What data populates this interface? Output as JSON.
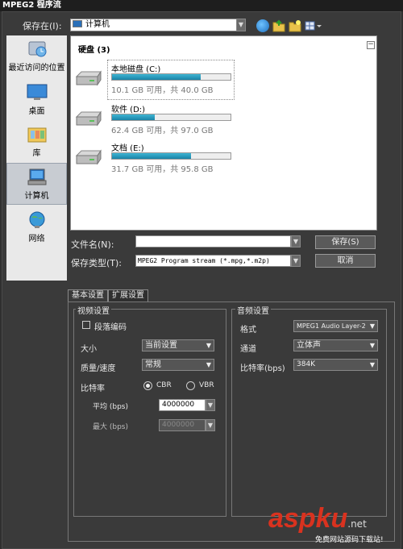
{
  "window": {
    "title": "MPEG2 程序流"
  },
  "save_in": {
    "label": "保存在(I):",
    "value": "计算机"
  },
  "places": [
    {
      "label": "最近访问的位置",
      "icon": "recent-places-icon",
      "selected": false
    },
    {
      "label": "桌面",
      "icon": "desktop-icon",
      "selected": false
    },
    {
      "label": "库",
      "icon": "library-icon",
      "selected": false
    },
    {
      "label": "计算机",
      "icon": "computer-icon",
      "selected": true
    },
    {
      "label": "网络",
      "icon": "network-icon",
      "selected": false
    }
  ],
  "filelist": {
    "group_title": "硬盘 (3)",
    "drives": [
      {
        "name": "本地磁盘 (C:)",
        "size_text": "10.1 GB 可用，共 40.0 GB",
        "used_fraction": 0.75
      },
      {
        "name": "软件 (D:)",
        "size_text": "62.4 GB 可用，共 97.0 GB",
        "used_fraction": 0.36
      },
      {
        "name": "文档 (E:)",
        "size_text": "31.7 GB 可用，共 95.8 GB",
        "used_fraction": 0.67
      }
    ]
  },
  "file_name": {
    "label": "文件名(N):",
    "value": ""
  },
  "save_type": {
    "label": "保存类型(T):",
    "value": "MPEG2 Program stream (*.mpg,*.m2p)"
  },
  "buttons": {
    "save": "保存(S)",
    "cancel": "取消"
  },
  "tabs": [
    {
      "label": "基本设置",
      "active": true
    },
    {
      "label": "扩展设置",
      "active": false
    }
  ],
  "video": {
    "title": "视频设置",
    "paragraph_encoding": "段落编码",
    "size_label": "大小",
    "size_value": "当前设置",
    "quality_label": "质量/速度",
    "quality_value": "常规",
    "bitrate_label": "比特率",
    "cbr": "CBR",
    "vbr": "VBR",
    "avg_label": "平均 (bps)",
    "avg_value": "4000000",
    "max_label": "最大 (bps)",
    "max_value": "4000000"
  },
  "audio": {
    "title": "音频设置",
    "format_label": "格式",
    "format_value": "MPEG1 Audio Layer-2",
    "channel_label": "通道",
    "channel_value": "立体声",
    "bitrate_label": "比特率(bps)",
    "bitrate_value": "384K"
  },
  "watermark": {
    "brand": "aspku",
    "suffix": ".net",
    "tagline": "免费网站源码下载站!"
  },
  "colors": {
    "accent": "#1a83a7",
    "dialog_bg": "#3a3a3a",
    "watermark": "#d9321f"
  }
}
